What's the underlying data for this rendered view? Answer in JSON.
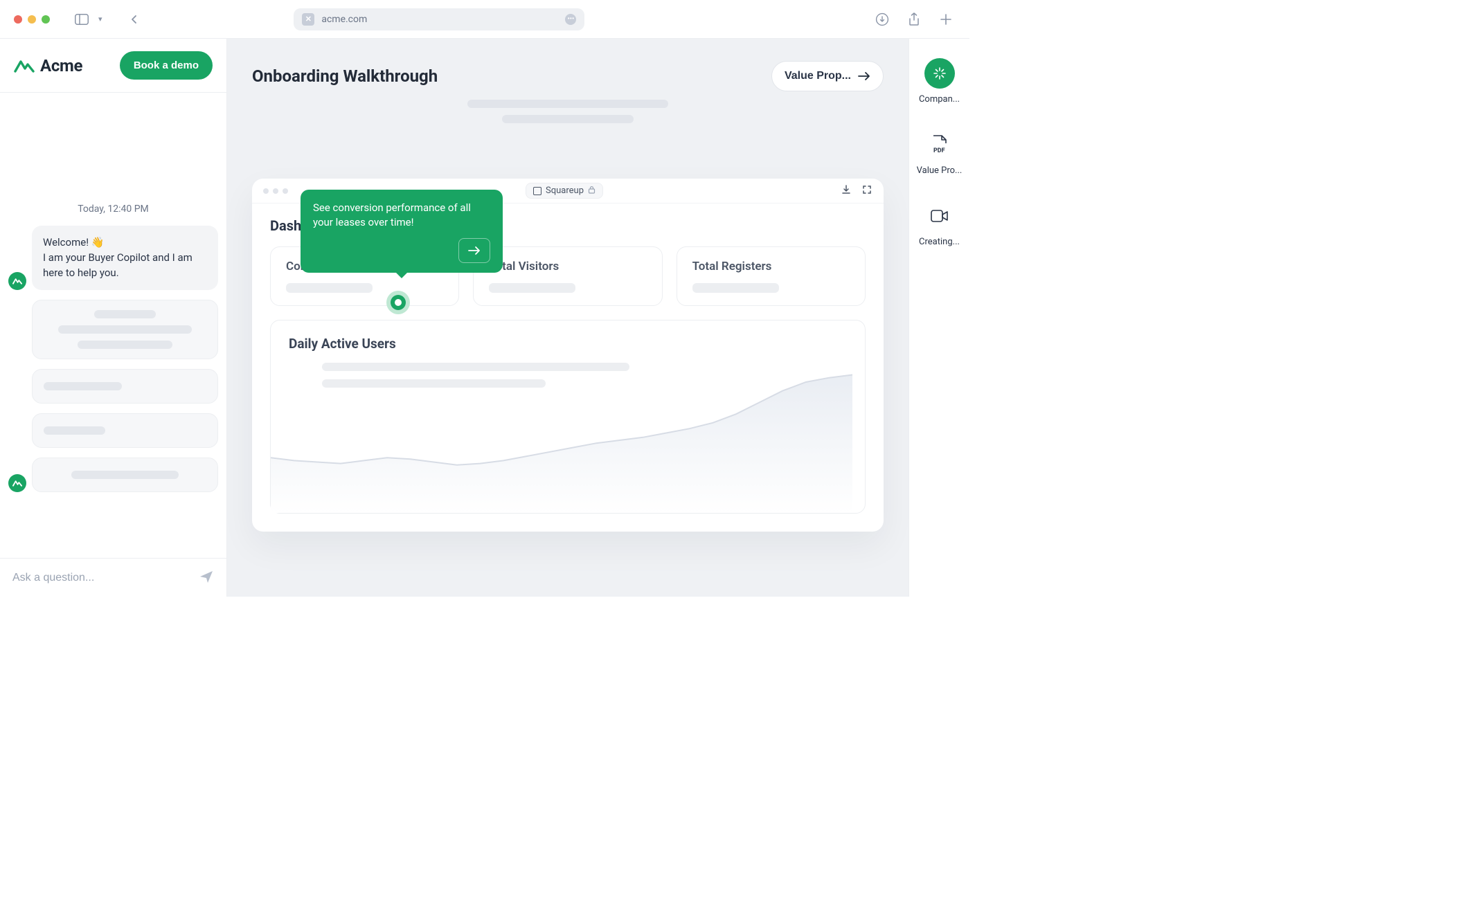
{
  "browser": {
    "url_display": "acme.com"
  },
  "brand": {
    "name": "Acme",
    "cta_label": "Book a demo"
  },
  "chat": {
    "timestamp": "Today, 12:40 PM",
    "welcome_greeting": "Welcome!",
    "welcome_body": "I am your Buyer Copilot and I am here to help you.",
    "composer_placeholder": "Ask a question..."
  },
  "page": {
    "title": "Onboarding Walkthrough",
    "next_button_label": "Value Prop..."
  },
  "mock": {
    "url_label": "Squareup",
    "dashboard_title": "Dashboard",
    "cards": [
      {
        "title": "Conversion Rate"
      },
      {
        "title": "Total Visitors"
      },
      {
        "title": "Total Registers"
      }
    ],
    "chart_title": "Daily Active Users",
    "tooltip_text": "See conversion performance of all your leases over time!"
  },
  "rail": {
    "items": [
      {
        "label": "Compan..."
      },
      {
        "label": "Value Pro..."
      },
      {
        "label": "Creating..."
      }
    ]
  },
  "chart_data": {
    "type": "line",
    "title": "Daily Active Users",
    "x": [
      0,
      1,
      2,
      3,
      4,
      5,
      6,
      7,
      8,
      9,
      10,
      11,
      12,
      13,
      14,
      15,
      16,
      17,
      18,
      19,
      20,
      21,
      22,
      23,
      24,
      25
    ],
    "values": [
      38,
      36,
      35,
      34,
      36,
      38,
      37,
      35,
      33,
      34,
      36,
      39,
      42,
      45,
      48,
      50,
      52,
      55,
      58,
      62,
      68,
      76,
      84,
      90,
      93,
      95
    ],
    "ylim": [
      0,
      100
    ],
    "xlabel": "",
    "ylabel": ""
  }
}
